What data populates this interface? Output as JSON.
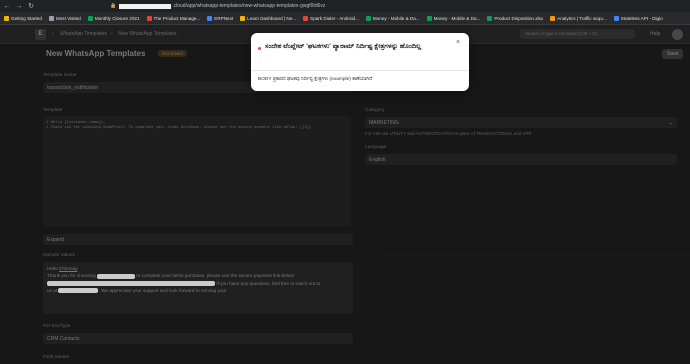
{
  "browser": {
    "url_tail": ".cloud/app/whatsapp-templates/new-whatsapp-templates-gwgf0td6vz",
    "bookmarks": [
      {
        "label": "Getting Started",
        "color": "#f4b400"
      },
      {
        "label": "Most Visited",
        "color": "#9aa0a6"
      },
      {
        "label": "Monthly Closure 2021",
        "color": "#0f9d58"
      },
      {
        "label": "The Product Manage...",
        "color": "#ea4335"
      },
      {
        "label": "ERPNext",
        "color": "#4285f4"
      },
      {
        "label": "Learn Dashboard | Ne...",
        "color": "#f4b400"
      },
      {
        "label": "Spark Dialer - Android...",
        "color": "#ea4335"
      },
      {
        "label": "Money - Mobile & Da...",
        "color": "#0f9d58"
      },
      {
        "label": "Money - Mobile & Da...",
        "color": "#0f9d58"
      },
      {
        "label": "Product Disposition.xlsx",
        "color": "#0f9d58"
      },
      {
        "label": "Analytics | Traffic acqu...",
        "color": "#f29900"
      },
      {
        "label": "Stateless API - Digio",
        "color": "#4285f4"
      }
    ]
  },
  "app": {
    "breadcrumb_1": "WhatsApp Templates",
    "breadcrumb_2": "New WhatsApp Templates",
    "search_placeholder": "Search or type a command (Ctrl + G)",
    "help_label": "Help"
  },
  "page": {
    "title": "New WhatsApp Templates",
    "status_badge": "Not Saved",
    "save_label": "Save"
  },
  "form": {
    "template_name_label": "Template Name",
    "template_name_value": "transaction_notification",
    "template_label": "Template",
    "template_code_line1": "1  Hello {{customer_name}},",
    "template_code_line2": "2  Thank you for choosing RoboPrint! To complete your items purchase, please use the secure payment link below: {{1}}",
    "category_label": "Category",
    "category_value": "MARKETING",
    "category_help": "For VIN use UTILITY and AUTHENTICATION in place of TRANSACTIONAL and OTP.",
    "language_label": "Language",
    "language_value": "English",
    "expand_label": "Expand",
    "sample_label": "Sample Values",
    "sample_hello": "Hello",
    "sample_name": "Chinmay",
    "sample_l2a": "Thank you for choosing",
    "sample_l2b": "to complete your items purchase, please use the secure payment link below:",
    "sample_l3": "If you have any questions, feel free to reach out to",
    "sample_l4a": "us at",
    "sample_l4b": ". We appreciate your support and look forward to serving you!",
    "for_doctype_label": "For DocType",
    "for_doctype_value": "CRM Contacts",
    "field_names_label": "Field names"
  },
  "modal": {
    "title": "ಸಂದೇಶ ಟೆಂಪ್ಲೇಟ್ 'ಘಟಕಗಳು' ಪ್ಯಾರಾಮ್ ನಿರ್ದಿಷ್ಟ ಕ್ಷೇತ್ರಗಳನ್ನು ಹೊಂದಿಲ್ಲ",
    "body": "BODY ಪ್ರಕಾರದ ಘಟಕವು ನಿರ್ದಿಷ್ಟ ಕ್ಷೇತ್ರಗಳು (example) ಕಾಣೆಯಾಗಿದೆ",
    "close_glyph": "×",
    "dot_color": "#e24c4b"
  }
}
